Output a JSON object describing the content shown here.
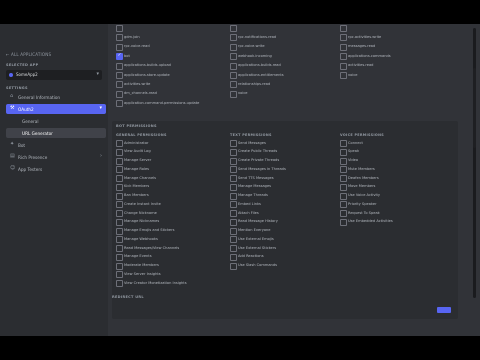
{
  "sidebar": {
    "back_label": "← ALL APPLICATIONS",
    "section_app": "SELECTED APP",
    "app_name": "SomeApp2",
    "section_settings": "SETTINGS",
    "items": [
      {
        "label": "General Information",
        "icon": "home-icon"
      },
      {
        "label": "OAuth2",
        "icon": "wrench-icon",
        "active": true
      },
      {
        "label": "General",
        "sub": true
      },
      {
        "label": "URL Generator",
        "sub": true,
        "selected": true
      },
      {
        "label": "Bot",
        "icon": "puzzle-icon"
      },
      {
        "label": "Rich Presence",
        "icon": "document-icon",
        "expandable": true
      },
      {
        "label": "App Testers",
        "icon": "person-icon"
      }
    ]
  },
  "scopes": {
    "columns": [
      [
        {
          "label": "",
          "checked": false
        },
        {
          "label": "gdm.join",
          "checked": false
        },
        {
          "label": "rpc.voice.read",
          "checked": false
        },
        {
          "label": "bot",
          "checked": true
        },
        {
          "label": "applications.builds.upload",
          "checked": false
        },
        {
          "label": "applications.store.update",
          "checked": false
        },
        {
          "label": "activities.write",
          "checked": false
        },
        {
          "label": "dm_channels.read",
          "checked": false
        },
        {
          "label": "application.command.permissions.update",
          "checked": false
        }
      ],
      [
        {
          "label": "",
          "checked": false
        },
        {
          "label": "rpc.notifications.read",
          "checked": false
        },
        {
          "label": "rpc.voice.write",
          "checked": false
        },
        {
          "label": "webhook.incoming",
          "checked": false
        },
        {
          "label": "applications.builds.read",
          "checked": false
        },
        {
          "label": "applications.entitlements",
          "checked": false
        },
        {
          "label": "relationships.read",
          "checked": false
        },
        {
          "label": "voice",
          "checked": false
        }
      ],
      [
        {
          "label": "",
          "checked": false
        },
        {
          "label": "rpc.activities.write",
          "checked": false
        },
        {
          "label": "messages.read",
          "checked": false
        },
        {
          "label": "applications.commands",
          "checked": false
        },
        {
          "label": "activities.read",
          "checked": false
        },
        {
          "label": "voice",
          "checked": false
        }
      ]
    ]
  },
  "bot_permissions": {
    "title": "BOT PERMISSIONS",
    "general": {
      "header": "GENERAL PERMISSIONS",
      "items": [
        {
          "label": "Administrator",
          "checked": false
        },
        {
          "label": "View Audit Log",
          "checked": false
        },
        {
          "label": "Manage Server",
          "checked": false
        },
        {
          "label": "Manage Roles",
          "checked": false
        },
        {
          "label": "Manage Channels",
          "checked": false
        },
        {
          "label": "Kick Members",
          "checked": false
        },
        {
          "label": "Ban Members",
          "checked": false
        },
        {
          "label": "Create Instant Invite",
          "checked": false
        },
        {
          "label": "Change Nickname",
          "checked": false
        },
        {
          "label": "Manage Nicknames",
          "checked": false
        },
        {
          "label": "Manage Emojis and Stickers",
          "checked": false
        },
        {
          "label": "Manage Webhooks",
          "checked": false
        },
        {
          "label": "Read Messages/View Channels",
          "checked": false
        },
        {
          "label": "Manage Events",
          "checked": false
        },
        {
          "label": "Moderate Members",
          "checked": false
        },
        {
          "label": "View Server Insights",
          "checked": false
        },
        {
          "label": "View Creator Monetization Insights",
          "checked": false
        }
      ]
    },
    "text": {
      "header": "TEXT PERMISSIONS",
      "items": [
        {
          "label": "Send Messages",
          "checked": false
        },
        {
          "label": "Create Public Threads",
          "checked": false
        },
        {
          "label": "Create Private Threads",
          "checked": false
        },
        {
          "label": "Send Messages in Threads",
          "checked": false
        },
        {
          "label": "Send TTS Messages",
          "checked": false
        },
        {
          "label": "Manage Messages",
          "checked": false
        },
        {
          "label": "Manage Threads",
          "checked": false
        },
        {
          "label": "Embed Links",
          "checked": false
        },
        {
          "label": "Attach Files",
          "checked": false
        },
        {
          "label": "Read Message History",
          "checked": false
        },
        {
          "label": "Mention Everyone",
          "checked": false
        },
        {
          "label": "Use External Emojis",
          "checked": false
        },
        {
          "label": "Use External Stickers",
          "checked": false
        },
        {
          "label": "Add Reactions",
          "checked": false
        },
        {
          "label": "Use Slash Commands",
          "checked": false
        }
      ]
    },
    "voice": {
      "header": "VOICE PERMISSIONS",
      "items": [
        {
          "label": "Connect",
          "checked": false
        },
        {
          "label": "Speak",
          "checked": false
        },
        {
          "label": "Video",
          "checked": false
        },
        {
          "label": "Mute Members",
          "checked": false
        },
        {
          "label": "Deafen Members",
          "checked": false
        },
        {
          "label": "Move Members",
          "checked": false
        },
        {
          "label": "Use Voice Activity",
          "checked": false
        },
        {
          "label": "Priority Speaker",
          "checked": false
        },
        {
          "label": "Request To Speak",
          "checked": false
        },
        {
          "label": "Use Embedded Activities",
          "checked": false
        }
      ]
    }
  },
  "redirect_label": "REDIRECT URL",
  "colors": {
    "accent": "#5865f2",
    "sidebar": "#2b2d31",
    "main": "#313338"
  }
}
